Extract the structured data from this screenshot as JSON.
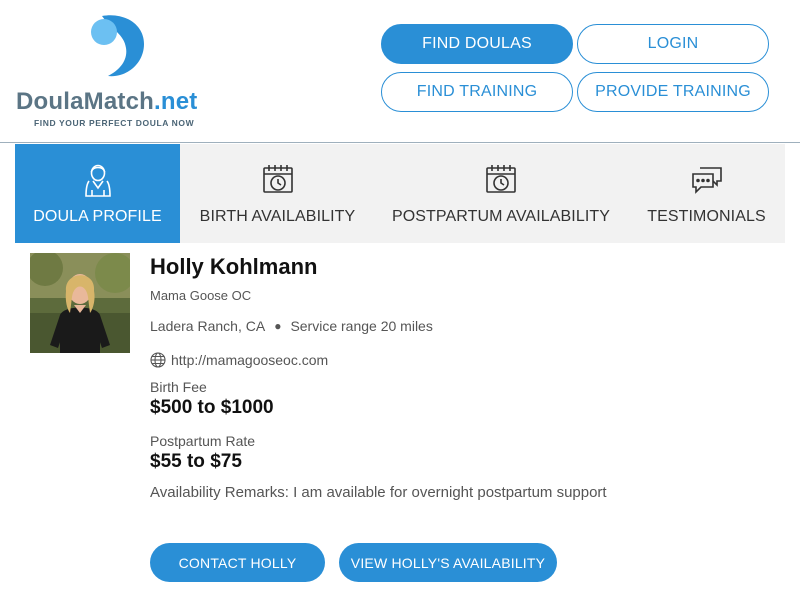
{
  "header": {
    "logo": {
      "name_part1": "Doula",
      "name_part2": "Match",
      "name_part3": ".net",
      "tagline": "FIND YOUR PERFECT DOULA NOW"
    },
    "nav": {
      "find_doulas": "FIND DOULAS",
      "login": "LOGIN",
      "find_training": "FIND TRAINING",
      "provide_training": "PROVIDE TRAINING"
    }
  },
  "tabs": [
    {
      "label": "DOULA PROFILE",
      "icon": "doula-person-icon",
      "active": true
    },
    {
      "label": "BIRTH AVAILABILITY",
      "icon": "calendar-clock-icon",
      "active": false
    },
    {
      "label": "POSTPARTUM AVAILABILITY",
      "icon": "calendar-clock-icon",
      "active": false
    },
    {
      "label": "TESTIMONIALS",
      "icon": "chat-bubbles-icon",
      "active": false
    }
  ],
  "profile": {
    "name": "Holly Kohlmann",
    "business": "Mama Goose OC",
    "city": "Ladera Ranch, CA",
    "service_range": "Service range 20 miles",
    "website": "http://mamagooseoc.com",
    "birth_fee_label": "Birth Fee",
    "birth_fee": "$500 to $1000",
    "postpartum_rate_label": "Postpartum Rate",
    "postpartum_rate": "$55 to $75",
    "remarks": "Availability Remarks: I am available for overnight postpartum support",
    "contact_label": "CONTACT HOLLY",
    "availability_label": "VIEW HOLLY'S AVAILABILITY"
  },
  "colors": {
    "accent": "#2a8fd6",
    "tab_bg": "#f2f2f2",
    "text_dark": "#111111",
    "text_muted": "#555555"
  }
}
